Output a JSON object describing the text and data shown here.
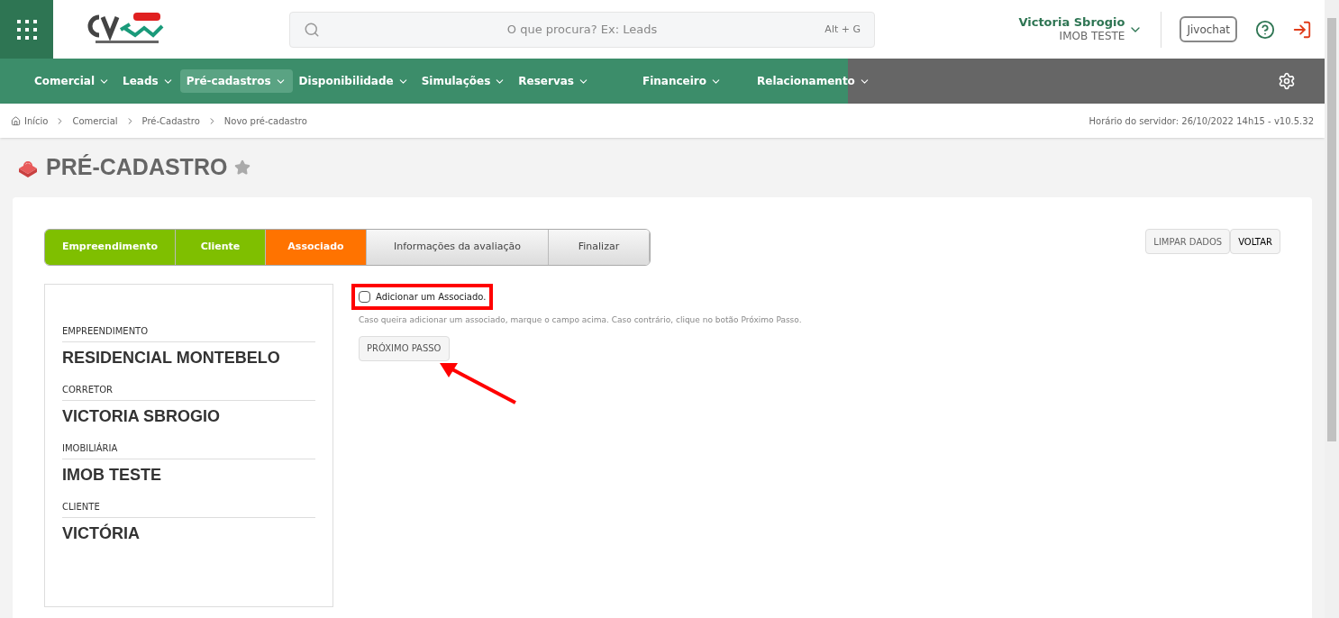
{
  "header": {
    "search": {
      "placeholder": "O que procura? Ex: Leads",
      "shortcut": "Alt + G"
    },
    "user": {
      "name": "Victoria Sbrogio",
      "company": "IMOB TESTE"
    },
    "chat_button": "Jivochat"
  },
  "nav": [
    {
      "label": "Comercial",
      "selected": false
    },
    {
      "label": "Leads",
      "selected": false
    },
    {
      "label": "Pré-cadastros",
      "selected": true
    },
    {
      "label": "Disponibilidade",
      "selected": false
    },
    {
      "label": "Simulações",
      "selected": false
    },
    {
      "label": "Reservas",
      "selected": false
    },
    {
      "label": "Financeiro",
      "selected": false
    },
    {
      "label": "Relacionamento",
      "selected": false
    }
  ],
  "breadcrumb": [
    "Início",
    "Comercial",
    "Pré-Cadastro",
    "Novo pré-cadastro"
  ],
  "server_time": "Horário do servidor: 26/10/2022 14h15 - v10.5.32",
  "page_title": "PRÉ-CADASTRO",
  "steps": [
    {
      "label": "Empreendimento",
      "kind": "done"
    },
    {
      "label": "Cliente",
      "kind": "done"
    },
    {
      "label": "Associado",
      "kind": "current"
    },
    {
      "label": "Informações da avaliação",
      "kind": "todo"
    },
    {
      "label": "Finalizar",
      "kind": "todo"
    }
  ],
  "actions": [
    "LIMPAR DADOS",
    "VOLTAR"
  ],
  "summary": [
    {
      "label": "EMPREENDIMENTO",
      "value": "RESIDENCIAL MONTEBELO"
    },
    {
      "label": "CORRETOR",
      "value": "VICTORIA SBROGIO"
    },
    {
      "label": "IMOBILIÁRIA",
      "value": "IMOB TESTE"
    },
    {
      "label": "CLIENTE",
      "value": "VICTÓRIA"
    }
  ],
  "associate": {
    "label": "Adicionar um Associado.",
    "checked": false,
    "hint": "Caso queira adicionar um associado, marque o campo acima. Caso contrário, clique no botão Próximo Passo.",
    "next_button": "PRÓXIMO PASSO"
  }
}
